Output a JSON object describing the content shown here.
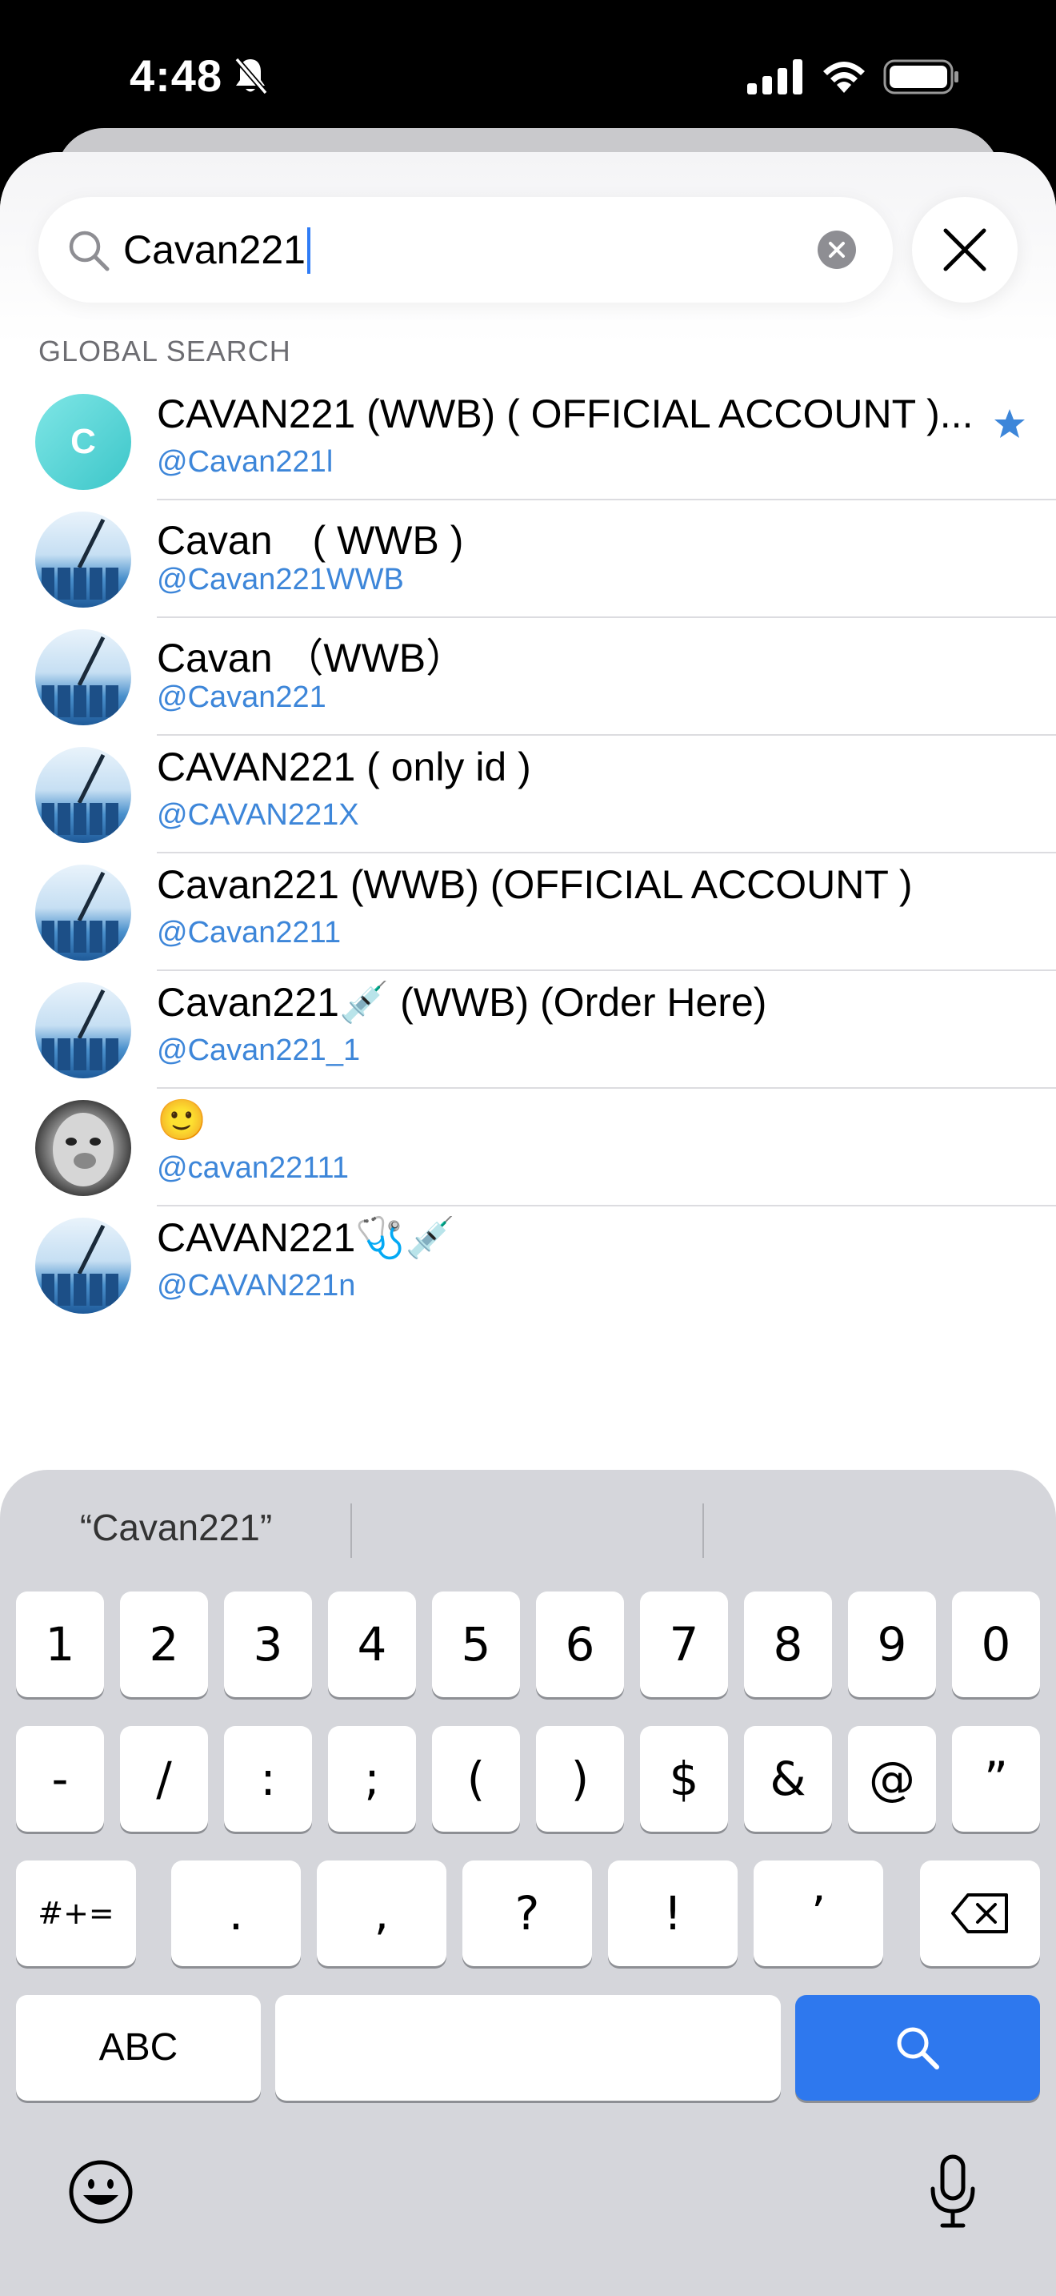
{
  "status_bar": {
    "time": "4:48"
  },
  "search": {
    "query": "Cavan221",
    "clear_icon": "clear-circle-icon",
    "close_icon": "close-icon"
  },
  "section_label": "GLOBAL SEARCH",
  "results": [
    {
      "title": "CAVAN221 (WWB) ( OFFICIAL ACCOUNT )...",
      "handle": "@Cavan221l",
      "avatar": "C",
      "avatar_type": "letter",
      "verified": true
    },
    {
      "title": "Cavan　( WWB )",
      "handle": "@Cavan221WWB",
      "avatar_type": "vial"
    },
    {
      "title": "Cavan （WWB）",
      "handle": "@Cavan221",
      "avatar_type": "vial"
    },
    {
      "title": "CAVAN221 ( only id )",
      "handle": "@CAVAN221X",
      "avatar_type": "vial"
    },
    {
      "title": "Cavan221 (WWB) (OFFICIAL ACCOUNT )",
      "handle": "@Cavan2211",
      "avatar_type": "vial"
    },
    {
      "title": "Cavan221💉 (WWB) (Order Here)",
      "handle": "@Cavan221_1",
      "avatar_type": "vial"
    },
    {
      "title": "🙂",
      "handle": "@cavan22111",
      "avatar_type": "face"
    },
    {
      "title": "CAVAN221🩺💉",
      "handle": "@CAVAN221n",
      "avatar_type": "vial"
    }
  ],
  "keyboard": {
    "suggestion": "“Cavan221”",
    "row1": [
      "1",
      "2",
      "3",
      "4",
      "5",
      "6",
      "7",
      "8",
      "9",
      "0"
    ],
    "row2": [
      "-",
      "/",
      ":",
      ";",
      "(",
      ")",
      "$",
      "&",
      "@",
      "”"
    ],
    "row3_mode": "#+=",
    "row3": [
      ".",
      ",",
      "?",
      "!",
      "’"
    ],
    "abc": "ABC",
    "search_icon": "search-icon",
    "emoji_icon": "emoji-icon",
    "mic_icon": "microphone-icon",
    "accent": "#2e78ee"
  },
  "colors": {
    "link": "#3d86d9",
    "accent": "#2f7cf6"
  }
}
